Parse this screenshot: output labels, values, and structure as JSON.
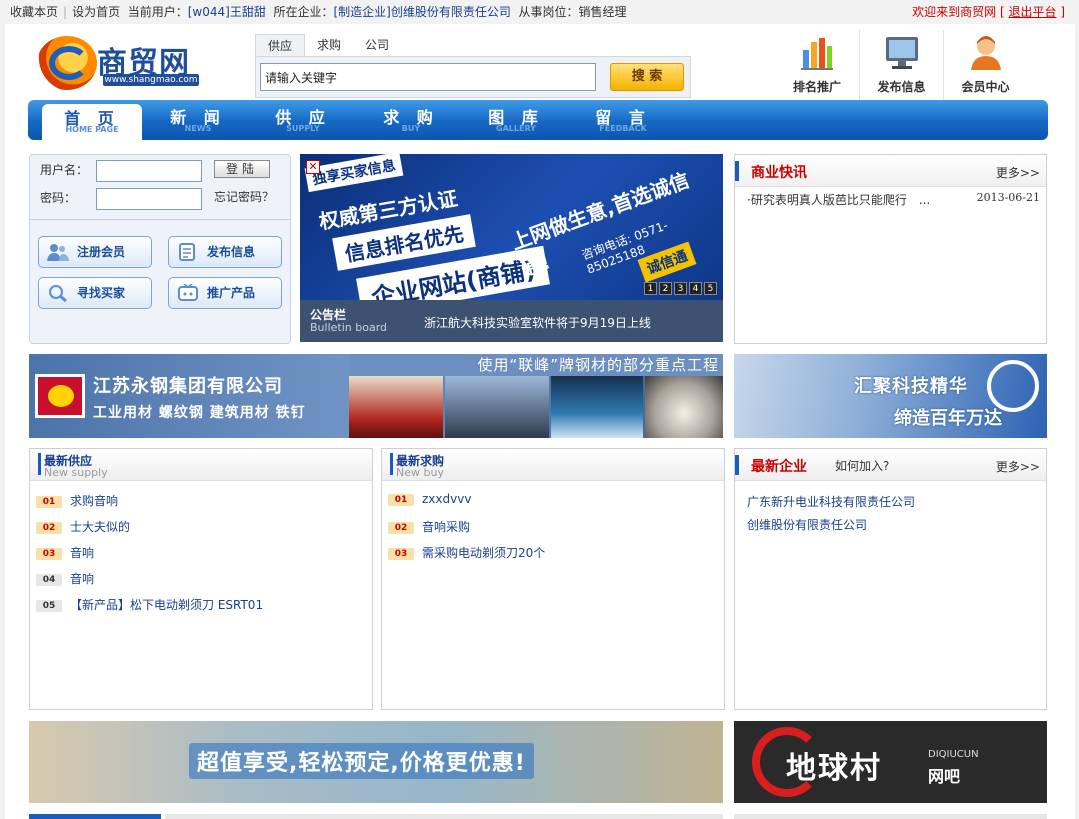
{
  "topbar": {
    "favorite": "收藏本页",
    "set_home": "设为首页",
    "current_user_label": "当前用户：",
    "current_user": "[w044]王甜甜",
    "company_label": "所在企业：",
    "company": "[制造企业]创维股份有限责任公司",
    "position_label": "从事岗位：",
    "position": "销售经理",
    "welcome": "欢迎来到商贸网",
    "logout": "退出平台"
  },
  "logo": {
    "name": "商贸网",
    "url": "www.shangmao.com"
  },
  "search": {
    "tabs": [
      "供应",
      "求购",
      "公司"
    ],
    "active_tab": 0,
    "placeholder": "请输入关键字",
    "value": "请输入关键字",
    "button": "搜 索"
  },
  "header_icons": [
    {
      "label": "排名推广",
      "icon": "ranking-chart-icon"
    },
    {
      "label": "发布信息",
      "icon": "monitor-icon"
    },
    {
      "label": "会员中心",
      "icon": "user-avatar-icon"
    }
  ],
  "nav": [
    {
      "cn": "首 页",
      "en": "HOME PAGE",
      "active": true
    },
    {
      "cn": "新 闻",
      "en": "NEWS"
    },
    {
      "cn": "供 应",
      "en": "SUPPLY"
    },
    {
      "cn": "求 购",
      "en": "BUY"
    },
    {
      "cn": "图 库",
      "en": "GALLERY"
    },
    {
      "cn": "留 言",
      "en": "FEEDBACK"
    }
  ],
  "login": {
    "username_label": "用户名：",
    "password_label": "密码：",
    "login_button": "登陆",
    "forgot": "忘记密码？",
    "buttons": [
      "注册会员",
      "发布信息",
      "寻找买家",
      "推广产品"
    ]
  },
  "banner": {
    "line1": "独享买家信息",
    "line2": "权威第三方认证",
    "line3": "信息排名优先",
    "line4": "企业网站(商铺)",
    "line5": "上网做生意,首选诚信通!",
    "phone": "咨询电话: 0571-85025188",
    "brand": "诚信通",
    "pages": [
      "1",
      "2",
      "3",
      "4",
      "5"
    ],
    "bulletin_title": "公告栏",
    "bulletin_en": "Bulletin board",
    "bulletin_msg": "浙江航大科技实验室软件将于9月19日上线"
  },
  "business_news": {
    "title": "商业快讯",
    "more": "更多>>",
    "items": [
      {
        "title": "·研究表明真人版芭比只能爬行　...",
        "date": "2013-06-21"
      }
    ]
  },
  "ad_left": {
    "company": "江苏永钢集团有限公司",
    "products": "工业用材 螺纹钢 建筑用材 铁钉",
    "caption": "使用“联峰”牌钢材的部分重点工程"
  },
  "ad_right": {
    "line1": "汇聚科技精华",
    "line2": "缔造百年万达"
  },
  "new_supply": {
    "title": "最新供应",
    "en": "New supply",
    "items": [
      {
        "num": "01",
        "text": "求购音响"
      },
      {
        "num": "02",
        "text": "士大夫似的"
      },
      {
        "num": "03",
        "text": "音响"
      },
      {
        "num": "04",
        "text": "音响"
      },
      {
        "num": "05",
        "text": "【新产品】松下电动剃须刀 ESRT01"
      }
    ]
  },
  "new_buy": {
    "title": "最新求购",
    "en": "New buy",
    "items": [
      {
        "num": "01",
        "text": "zxxdvvv"
      },
      {
        "num": "02",
        "text": "音响采购"
      },
      {
        "num": "03",
        "text": "需采购电动剃须刀20个"
      }
    ]
  },
  "new_enterprise": {
    "title": "最新企业",
    "how_to_join": "如何加入?",
    "more": "更多>>",
    "items": [
      "广东新升电业科技有限责任公司",
      "创维股份有限责任公司"
    ]
  },
  "bottom_left": {
    "slogan": "超值享受,轻松预定,价格更优惠!"
  },
  "bottom_right": {
    "name": "地球村",
    "en": "DIQIUCUN",
    "suffix": "网吧"
  },
  "colors": {
    "nav_blue": "#1667c4",
    "accent_red": "#cc0000",
    "link_blue": "#1a3f8c"
  }
}
